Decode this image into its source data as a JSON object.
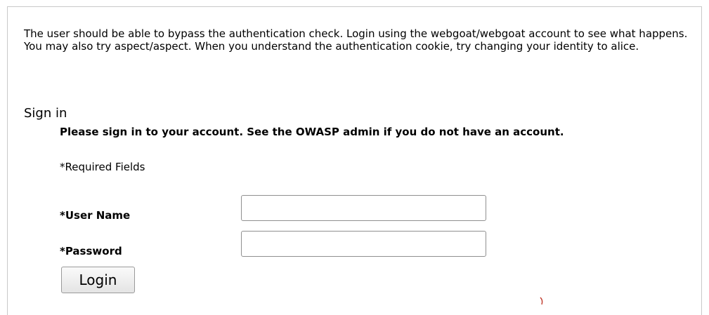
{
  "lesson": {
    "instructions": "The user should be able to bypass the authentication check. Login using the webgoat/webgoat account to see what happens. You may also try aspect/aspect. When you understand the authentication cookie, try changing your identity to alice."
  },
  "signin": {
    "heading": "Sign in",
    "description": "Please sign in to your account. See the OWASP admin if you do not have an account.",
    "required_note": "*Required Fields",
    "username_label": "*User Name",
    "username_value": "",
    "password_label": "*Password",
    "password_value": "",
    "login_button": "Login"
  },
  "colors": {
    "panel_border": "#c8c8c8",
    "input_border": "#8f8f8f",
    "stray_mark": "#c0392b"
  }
}
